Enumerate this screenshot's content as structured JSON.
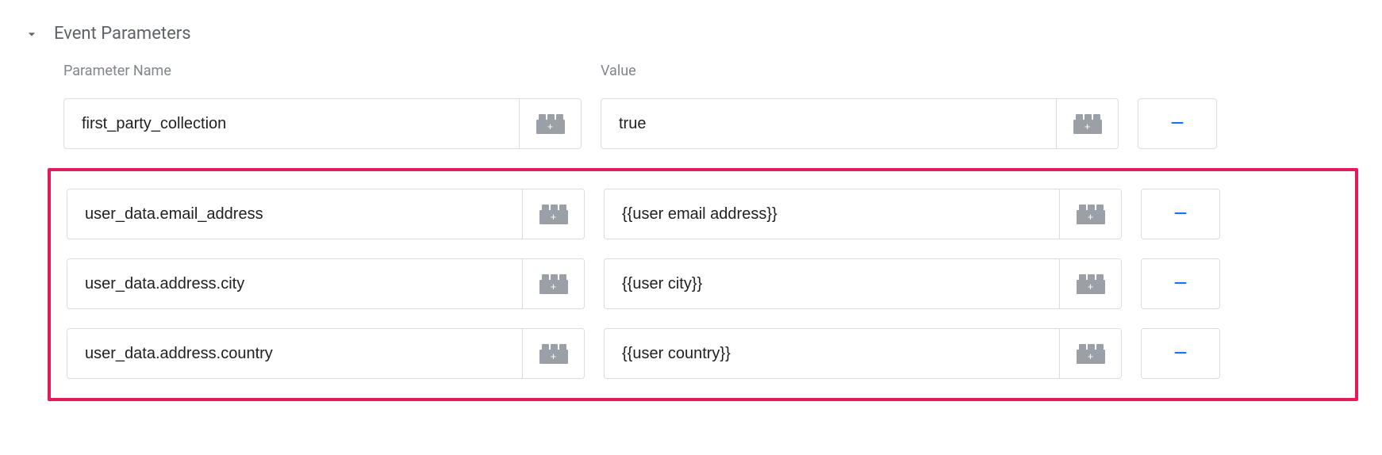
{
  "section": {
    "title": "Event Parameters",
    "col_param": "Parameter Name",
    "col_value": "Value"
  },
  "rows": [
    {
      "param": "first_party_collection",
      "value": "true"
    },
    {
      "param": "user_data.email_address",
      "value": "{{user email address}}"
    },
    {
      "param": "user_data.address.city",
      "value": "{{user city}}"
    },
    {
      "param": "user_data.address.country",
      "value": "{{user country}}"
    }
  ],
  "buttons": {
    "remove_glyph": "−"
  }
}
